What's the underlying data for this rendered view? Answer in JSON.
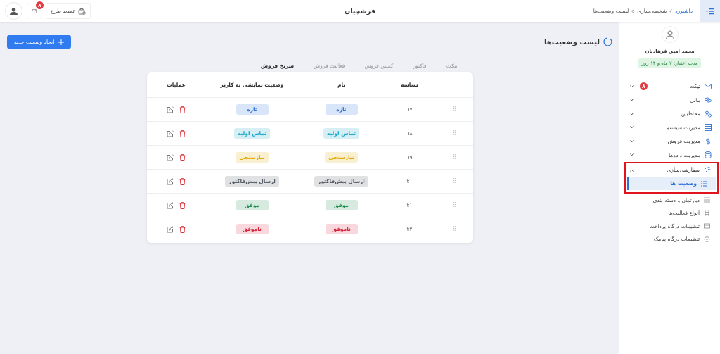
{
  "header": {
    "title": "فرشچیان",
    "breadcrumb": [
      "داشبورد",
      "شخصی‌سازی",
      "لیست وضعیت‌ها"
    ],
    "renew_button": "تمدید طرح",
    "mail_badge": "۸"
  },
  "sidebar": {
    "user_name": "محمد امین فرهادیان",
    "subscription": "مدت اعتبار: ۷ ماه و ۱۴ روز",
    "items": [
      {
        "label": "تیکت",
        "badge": "۸",
        "expanded": false,
        "highlighted": false
      },
      {
        "label": "مالی",
        "expanded": false,
        "highlighted": false
      },
      {
        "label": "مخاطبین",
        "expanded": false,
        "highlighted": false
      },
      {
        "label": "مدیریت سیستم",
        "expanded": false,
        "highlighted": false
      },
      {
        "label": "مدیریت فروش",
        "expanded": false,
        "highlighted": false
      },
      {
        "label": "مدیریت داده‌ها",
        "expanded": false,
        "highlighted": false
      },
      {
        "label": "سفارشی‌سازی",
        "expanded": true,
        "highlighted": true,
        "children": [
          {
            "label": "وضعیت ها",
            "selected": true
          },
          {
            "label": "دپارتمان و دسته بندی",
            "selected": false
          },
          {
            "label": "انواع فعالیت‌ها",
            "selected": false
          },
          {
            "label": "تنظیمات درگاه پرداخت",
            "selected": false
          },
          {
            "label": "تنظیمات درگاه پیامک",
            "selected": false
          }
        ]
      }
    ]
  },
  "page": {
    "title": "لیست وضعیت‌ها",
    "create_button": "ایجاد وضعیت جدید"
  },
  "tabs": [
    {
      "label": "تیکت",
      "selected": false
    },
    {
      "label": "فاکتور",
      "selected": false
    },
    {
      "label": "کمپین فروش",
      "selected": false
    },
    {
      "label": "فعالیت فروش",
      "selected": false
    },
    {
      "label": "سرنخ فروش",
      "selected": true
    }
  ],
  "table": {
    "columns": [
      "شناسه",
      "نام",
      "وضعیت نمایشی به کاربر",
      "عملیات"
    ],
    "rows": [
      {
        "id": "۱۷",
        "name": "تازه",
        "display": "تازه",
        "color": "#2f6fd6"
      },
      {
        "id": "۱۸",
        "name": "تماس اولیه",
        "display": "تماس اولیه",
        "color": "#1ba8c9"
      },
      {
        "id": "۱۹",
        "name": "نیازسنجی",
        "display": "نیازسنجی",
        "color": "#e0a800"
      },
      {
        "id": "۲۰",
        "name": "ارسال پیش‌فاکتور",
        "display": "ارسال پیش‌فاکتور",
        "color": "#555b66"
      },
      {
        "id": "۲۱",
        "name": "موفق",
        "display": "موفق",
        "color": "#1e8a4c"
      },
      {
        "id": "۲۲",
        "name": "ناموفق",
        "display": "ناموفق",
        "color": "#d6263c"
      }
    ]
  }
}
